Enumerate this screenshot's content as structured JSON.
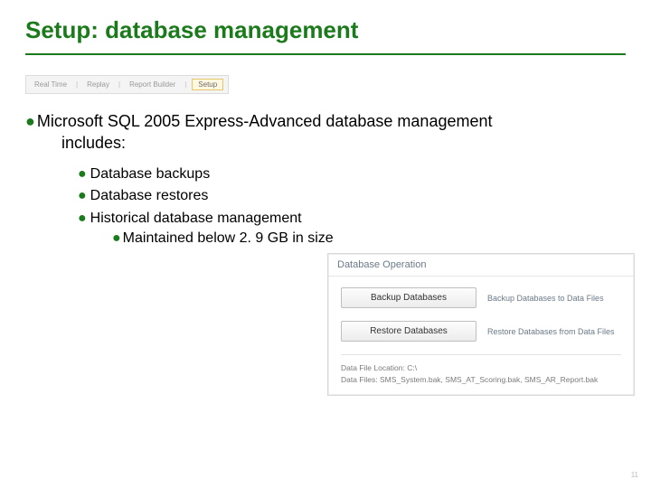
{
  "title": "Setup: database management",
  "nav": {
    "items": [
      "Real Time",
      "Replay",
      "Report Builder"
    ],
    "active": "Setup"
  },
  "bullets": {
    "lvl1_a": "Microsoft SQL 2005 Express-Advanced database management",
    "lvl1_b": "includes:",
    "lvl2": [
      "Database backups",
      "Database restores",
      "Historical database management"
    ],
    "lvl3": "Maintained below 2. 9 GB in size"
  },
  "panel": {
    "heading": "Database Operation",
    "rows": [
      {
        "button": "Backup Databases",
        "desc": "Backup Databases to Data Files"
      },
      {
        "button": "Restore Databases",
        "desc": "Restore Databases from Data Files"
      }
    ],
    "meta_loc_label": "Data File Location:",
    "meta_loc_value": "C:\\",
    "meta_files_label": "Data Files:",
    "meta_files_value": "SMS_System.bak, SMS_AT_Scoring.bak, SMS_AR_Report.bak"
  },
  "pagenum": "11"
}
